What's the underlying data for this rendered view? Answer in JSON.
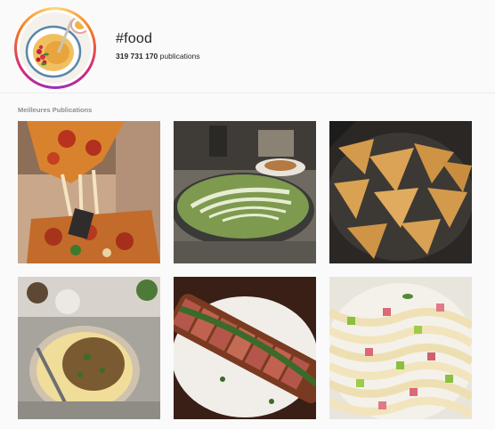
{
  "tag": {
    "title": "#food",
    "count_value": "319 731 170",
    "count_label": " publications"
  },
  "section": {
    "title": "Meilleures Publications"
  },
  "posts": [
    {
      "subject": "pizza-slice-cheese-pull"
    },
    {
      "subject": "matcha-latte-art"
    },
    {
      "subject": "samosas-in-pan"
    },
    {
      "subject": "lentil-stew-mashed-potatoes"
    },
    {
      "subject": "sliced-steak-chimichurri"
    },
    {
      "subject": "udon-noodles-vegetables"
    }
  ],
  "colors": {
    "ring_start": "#feda75",
    "ring_mid": "#d62976",
    "ring_end": "#962fbf",
    "muted_text": "#8e8e8e"
  }
}
